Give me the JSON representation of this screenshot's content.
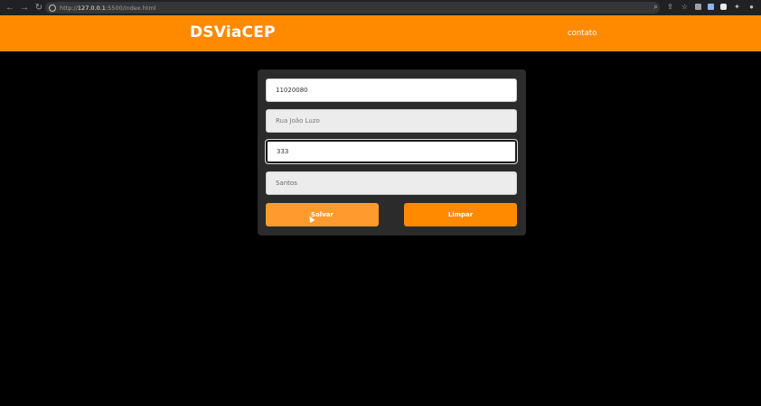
{
  "browser": {
    "url_scheme": "http://",
    "url_host": "127.0.0.1",
    "url_rest": ":5500/index.html"
  },
  "header": {
    "brand": "DSViaCEP",
    "nav_link": "contato",
    "accent_color": "#ff8a00"
  },
  "form": {
    "cep_value": "11020080",
    "rua_value": "Rua João Luzo",
    "numero_value": "333",
    "cidade_value": "Santos",
    "save_label": "Salvar",
    "clear_label": "Limpar"
  }
}
